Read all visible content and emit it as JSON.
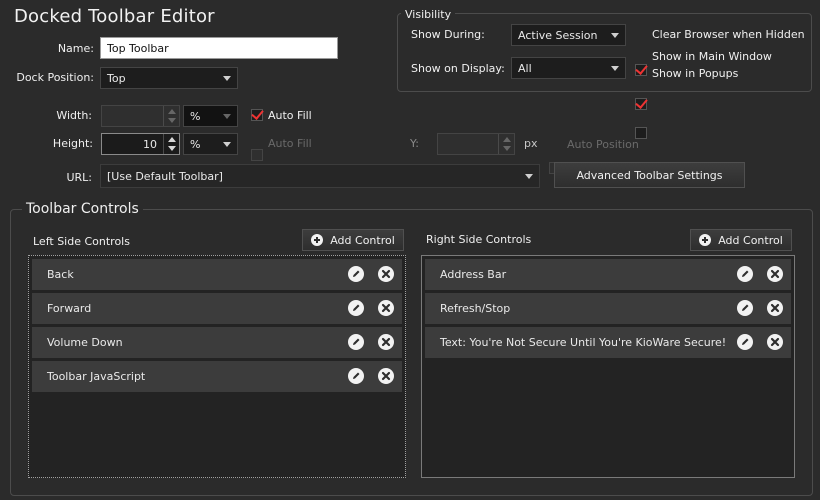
{
  "window": {
    "title": "Docked Toolbar Editor"
  },
  "form": {
    "name_label": "Name:",
    "name_value": "Top Toolbar",
    "dock_label": "Dock Position:",
    "dock_value": "Top",
    "width_label": "Width:",
    "width_value": "",
    "width_unit": "%",
    "width_autofill": "Auto Fill",
    "width_autofill_checked": true,
    "height_label": "Height:",
    "height_value": "10",
    "height_unit": "%",
    "height_autofill": "Auto Fill",
    "height_autofill_checked": false,
    "y_label": "Y:",
    "y_value": "",
    "y_unit": "px",
    "auto_position": "Auto Position",
    "url_label": "URL:",
    "url_value": "[Use Default Toolbar]",
    "advanced_button": "Advanced Toolbar Settings"
  },
  "visibility": {
    "title": "Visibility",
    "show_during_label": "Show During:",
    "show_during_value": "Active Session",
    "show_display_label": "Show on Display:",
    "show_display_value": "All",
    "clear_browser": "Clear Browser when Hidden",
    "clear_browser_checked": true,
    "show_main": "Show in Main Window",
    "show_main_checked": true,
    "show_popups": "Show in Popups",
    "show_popups_checked": false
  },
  "controls": {
    "title": "Toolbar Controls",
    "left_label": "Left Side Controls",
    "right_label": "Right Side Controls",
    "add_label": "Add Control",
    "left_items": [
      "Back",
      "Forward",
      "Volume Down",
      "Toolbar JavaScript"
    ],
    "right_items": [
      "Address Bar",
      "Refresh/Stop",
      "Text: You're Not Secure Until You're KioWare Secure!"
    ]
  },
  "colors": {
    "background": "#2b2b2b",
    "check_mark": "#ee3333",
    "row": "#3c3c3c"
  }
}
